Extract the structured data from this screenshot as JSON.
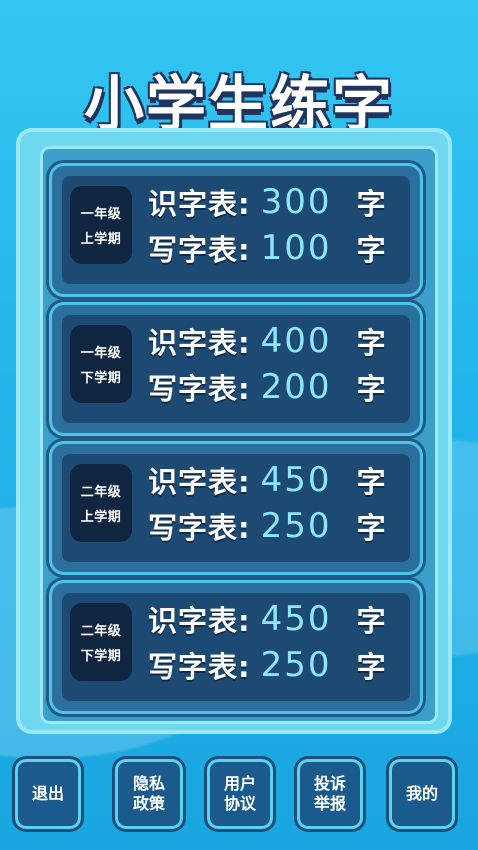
{
  "title": "小学生练字",
  "cards": [
    {
      "grade": "一年级",
      "term": "上学期",
      "recognize_label": "识字表:",
      "recognize_count": "300",
      "write_label": "写字表:",
      "write_count": "100",
      "unit": "字"
    },
    {
      "grade": "一年级",
      "term": "下学期",
      "recognize_label": "识字表:",
      "recognize_count": "400",
      "write_label": "写字表:",
      "write_count": "200",
      "unit": "字"
    },
    {
      "grade": "二年级",
      "term": "上学期",
      "recognize_label": "识字表:",
      "recognize_count": "450",
      "write_label": "写字表:",
      "write_count": "250",
      "unit": "字"
    },
    {
      "grade": "二年级",
      "term": "下学期",
      "recognize_label": "识字表:",
      "recognize_count": "450",
      "write_label": "写字表:",
      "write_count": "250",
      "unit": "字"
    }
  ],
  "bottom_nav": {
    "exit": [
      "退出"
    ],
    "privacy": [
      "隐私",
      "政策"
    ],
    "agreement": [
      "用户",
      "协议"
    ],
    "report": [
      "投诉",
      "举报"
    ],
    "mine": [
      "我的"
    ]
  },
  "colors": {
    "background": "#22b5ea",
    "card": "#1d4a73",
    "badge": "#10253f",
    "count_text": "#8fe6ff"
  }
}
